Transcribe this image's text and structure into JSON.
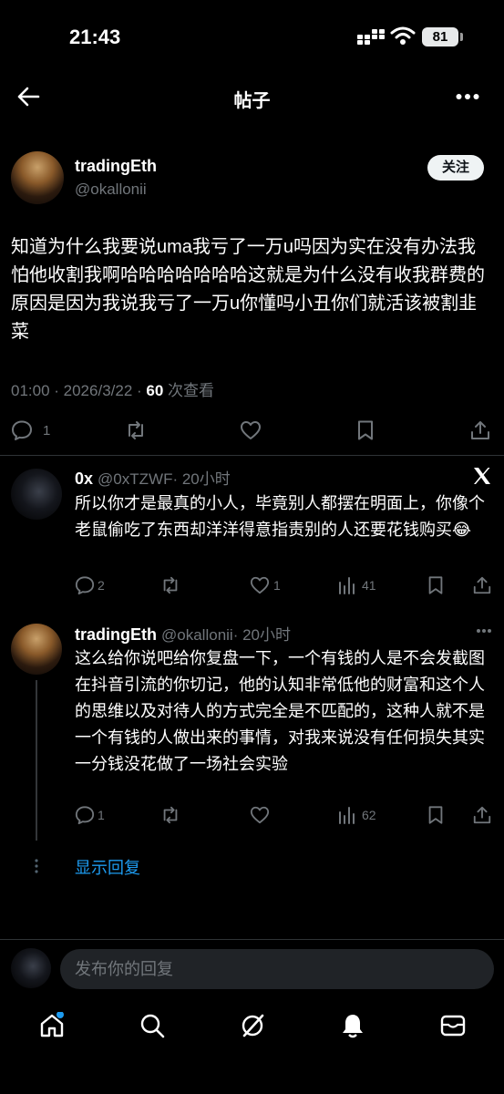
{
  "status_bar": {
    "time": "21:43",
    "battery": "81"
  },
  "header": {
    "title": "帖子"
  },
  "post": {
    "author_name": "tradingEth",
    "author_handle": "@okallonii",
    "follow_label": "关注",
    "text": "知道为什么我要说uma我亏了一万u吗因为实在没有办法我怕他收割我啊哈哈哈哈哈哈哈这就是为什么没有收我群费的原因是因为我说我亏了一万u你懂吗小丑你们就活该被割韭菜",
    "timestamp": "01:00 · 2026/3/22 · ",
    "views_count": "60",
    "views_label": " 次查看",
    "reply_count": "1"
  },
  "replies": [
    {
      "author_name": "0x",
      "author_handle": "@0xTZWF",
      "time": "· 20小时",
      "text": "所以你才是最真的小人，毕竟别人都摆在明面上，你像个老鼠偷吃了东西却洋洋得意指责别的人还要花钱购买😂",
      "reply_count": "2",
      "like_count": "1",
      "view_count": "41"
    },
    {
      "author_name": "tradingEth",
      "author_handle": "@okallonii",
      "time": "· 20小时",
      "text": "这么给你说吧给你复盘一下，一个有钱的人是不会发截图在抖音引流的你切记，他的认知非常低他的财富和这个人的思维以及对待人的方式完全是不匹配的，这种人就不是一个有钱的人做出来的事情，对我来说没有任何损失其实一分钱没花做了一场社会实验",
      "reply_count": "1",
      "view_count": "62"
    }
  ],
  "show_replies_label": "显示回复",
  "composer": {
    "placeholder": "发布你的回复"
  }
}
